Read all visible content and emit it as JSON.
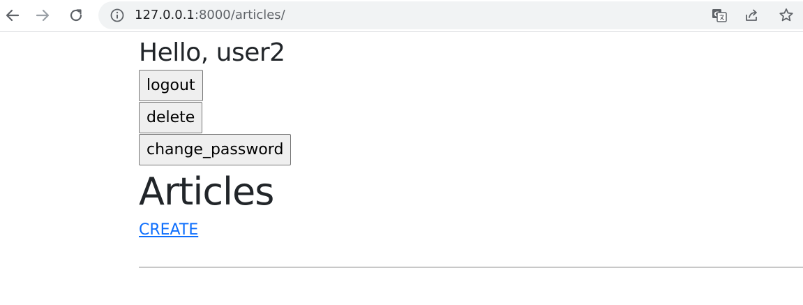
{
  "browser": {
    "back_icon": "arrow-left-icon",
    "forward_icon": "arrow-right-icon",
    "reload_icon": "reload-icon",
    "info_icon": "info-icon",
    "url_host": "127.0.0.1",
    "url_path": ":8000/articles/",
    "translate_icon": "translate-icon",
    "share_icon": "share-icon",
    "bookmark_icon": "star-icon"
  },
  "page": {
    "greeting": "Hello, user2",
    "buttons": {
      "logout": "logout",
      "delete": "delete",
      "change_password": "change_password"
    },
    "heading": "Articles",
    "create_link": "CREATE"
  },
  "colors": {
    "link": "#0d6efd",
    "text": "#212529",
    "omnibox_bg": "#f1f3f4",
    "divider": "#c8c8c8"
  }
}
